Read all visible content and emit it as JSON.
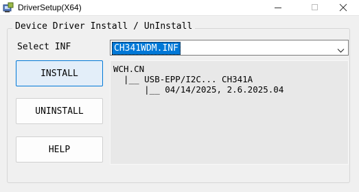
{
  "window": {
    "title": "DriverSetup(X64)",
    "icon": "installer-app-icon",
    "controls": [
      "minimize-icon",
      "maximize-icon",
      "close-icon"
    ]
  },
  "group": {
    "title": "Device Driver Install / UnInstall"
  },
  "select_inf": {
    "label": "Select INF",
    "value": "CH341WDM.INF"
  },
  "buttons": {
    "install": "INSTALL",
    "uninstall": "UNINSTALL",
    "help": "HELP"
  },
  "info": {
    "lines": [
      "WCH.CN",
      "  |__ USB-EPP/I2C... CH341A",
      "      |__ 04/14/2025, 2.6.2025.04"
    ]
  },
  "colors": {
    "selection": "#0078d7",
    "focus_border": "#0078d7",
    "background": "#f0f0f0"
  }
}
